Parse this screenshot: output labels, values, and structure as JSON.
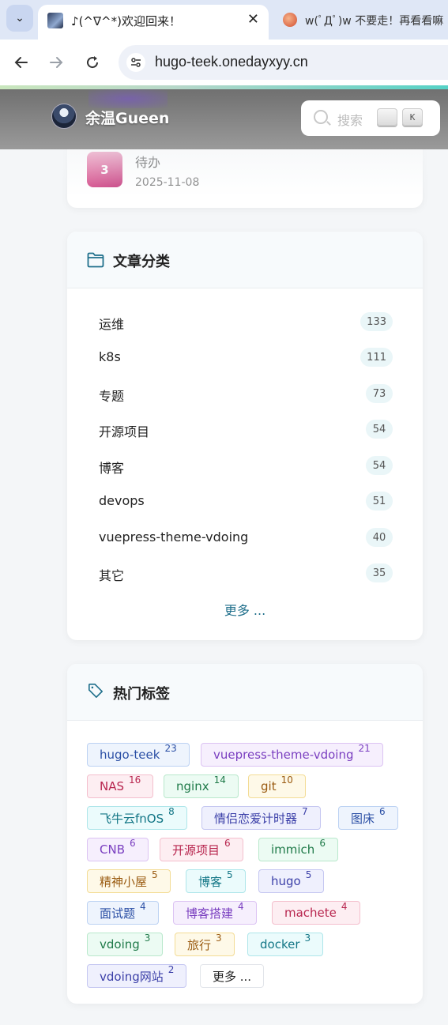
{
  "browser": {
    "active_tab_title": "♪(^∇^*)欢迎回来！",
    "inactive_tab_title": "w(ﾟДﾟ)w 不要走！再看看嘛",
    "url": "hugo-teek.onedayxyy.cn",
    "accent": "#55d2c6"
  },
  "site": {
    "title": "余温Gueen",
    "search_placeholder": "搜索",
    "shortcut_key": "K"
  },
  "top_post": {
    "rank": "3",
    "title": "待办",
    "date": "2025-11-08"
  },
  "categories": {
    "title": "文章分类",
    "items": [
      {
        "name": "运维",
        "count": "133"
      },
      {
        "name": "k8s",
        "count": "111"
      },
      {
        "name": "专题",
        "count": "73"
      },
      {
        "name": "开源项目",
        "count": "54"
      },
      {
        "name": "博客",
        "count": "54"
      },
      {
        "name": "devops",
        "count": "51"
      },
      {
        "name": "vuepress-theme-vdoing",
        "count": "40"
      },
      {
        "name": "其它",
        "count": "35"
      }
    ],
    "more_label": "更多 ..."
  },
  "tags": {
    "title": "热门标签",
    "items": [
      {
        "name": "hugo-teek",
        "count": "23",
        "color": "blue"
      },
      {
        "name": "vuepress-theme-vdoing",
        "count": "21",
        "color": "purple"
      },
      {
        "name": "NAS",
        "count": "16",
        "color": "pink"
      },
      {
        "name": "nginx",
        "count": "14",
        "color": "green"
      },
      {
        "name": "git",
        "count": "10",
        "color": "yellow"
      },
      {
        "name": "飞牛云fnOS",
        "count": "8",
        "color": "cyan"
      },
      {
        "name": "情侣恋爱计时器",
        "count": "7",
        "color": "indigo"
      },
      {
        "name": "图床",
        "count": "6",
        "color": "blue"
      },
      {
        "name": "CNB",
        "count": "6",
        "color": "purple"
      },
      {
        "name": "开源项目",
        "count": "6",
        "color": "pink"
      },
      {
        "name": "immich",
        "count": "6",
        "color": "green"
      },
      {
        "name": "精神小屋",
        "count": "5",
        "color": "yellow"
      },
      {
        "name": "博客",
        "count": "5",
        "color": "cyan"
      },
      {
        "name": "hugo",
        "count": "5",
        "color": "indigo"
      },
      {
        "name": "面试题",
        "count": "4",
        "color": "blue"
      },
      {
        "name": "博客搭建",
        "count": "4",
        "color": "purple"
      },
      {
        "name": "machete",
        "count": "4",
        "color": "pink"
      },
      {
        "name": "vdoing",
        "count": "3",
        "color": "green"
      },
      {
        "name": "旅行",
        "count": "3",
        "color": "yellow"
      },
      {
        "name": "docker",
        "count": "3",
        "color": "cyan"
      },
      {
        "name": "vdoing网站",
        "count": "2",
        "color": "indigo"
      }
    ],
    "more_label": "更多 ..."
  }
}
